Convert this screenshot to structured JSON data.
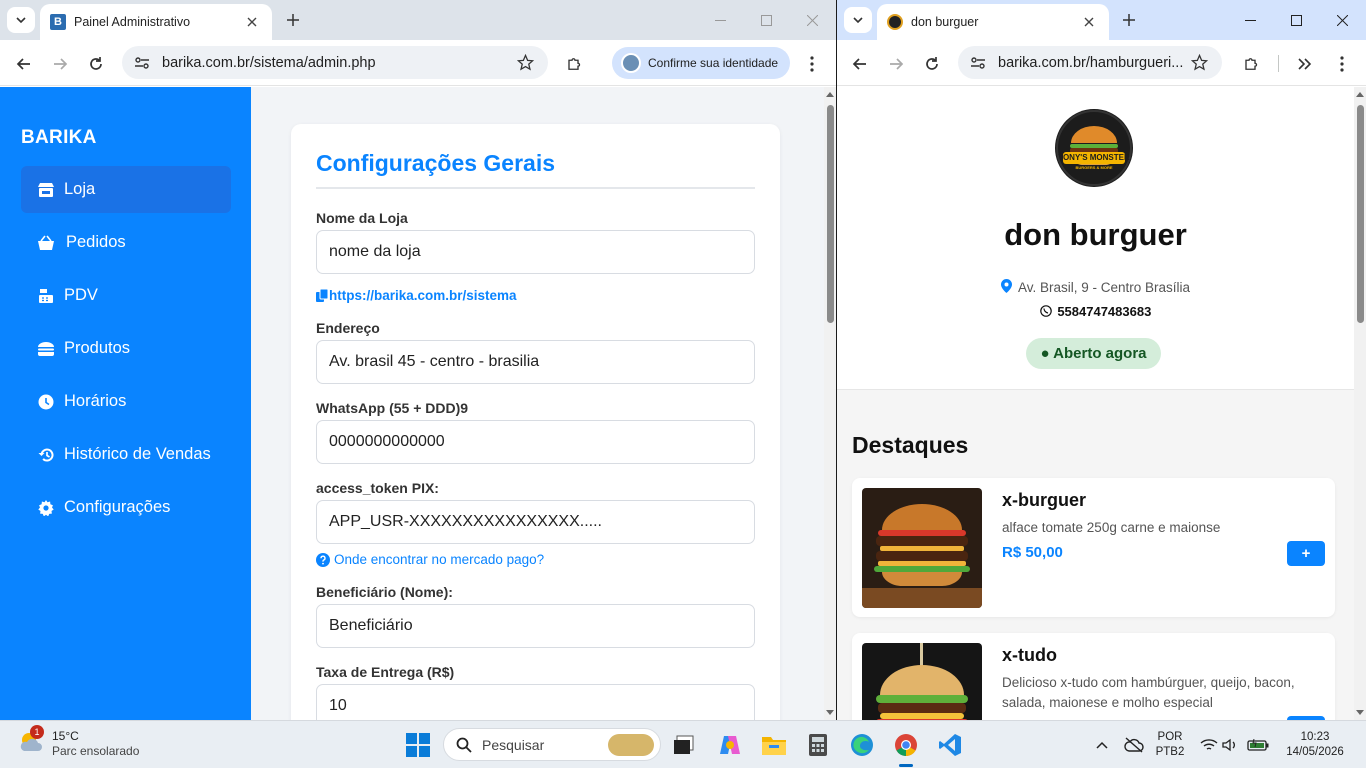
{
  "left_window": {
    "tab_title": "Painel Administrativo",
    "url": "barika.com.br/sistema/admin.php",
    "profile_button": "Confirme sua identidade"
  },
  "admin": {
    "brand": "BARIKA",
    "nav": [
      {
        "label": "Loja",
        "icon": "store-icon",
        "active": true
      },
      {
        "label": "Pedidos",
        "icon": "basket-icon"
      },
      {
        "label": "PDV",
        "icon": "cash-register-icon"
      },
      {
        "label": "Produtos",
        "icon": "burger-icon"
      },
      {
        "label": "Horários",
        "icon": "clock-icon"
      },
      {
        "label": "Histórico de Vendas",
        "icon": "history-icon"
      },
      {
        "label": "Configurações",
        "icon": "gear-icon"
      }
    ],
    "form": {
      "title": "Configurações Gerais",
      "store_name_label": "Nome da Loja",
      "store_name_value": "nome da loja",
      "store_link": "https://barika.com.br/sistema",
      "address_label": "Endereço",
      "address_value": "Av. brasil 45 - centro - brasilia",
      "whatsapp_label": "WhatsApp (55 + DDD)9",
      "whatsapp_value": "0000000000000",
      "pix_label": "access_token PIX:",
      "pix_value": "APP_USR-XXXXXXXXXXXXXXXX.....",
      "pix_help": "Onde encontrar no mercado pago?",
      "beneficiary_label": "Beneficiário (Nome):",
      "beneficiary_value": "Beneficiário",
      "delivery_label": "Taxa de Entrega (R$)",
      "delivery_value": "10"
    }
  },
  "right_window": {
    "tab_title": "don burguer",
    "url": "barika.com.br/hamburgueri..."
  },
  "store": {
    "logo_text": "TONY'S MONSTER",
    "logo_sub": "BURGERS & MORE",
    "name": "don burguer",
    "address": "Av. Brasil, 9 - Centro Brasília",
    "phone": "5584747483683",
    "status": "● Aberto agora",
    "section_title": "Destaques",
    "products": [
      {
        "name": "x-burguer",
        "description": "alface tomate 250g carne e maionse",
        "price": "R$ 50,00",
        "add": "+"
      },
      {
        "name": "x-tudo",
        "description": "Delicioso x-tudo com hambúrguer, queijo, bacon, salada, maionese e molho especial",
        "price": "",
        "add": "+"
      }
    ]
  },
  "taskbar": {
    "weather_temp": "15°C",
    "weather_desc": "Parc ensolarado",
    "weather_badge": "1",
    "search_placeholder": "Pesquisar",
    "lang_line1": "POR",
    "lang_line2": "PTB2",
    "time": "10:23",
    "date": "14/05/2026"
  },
  "colors": {
    "accent": "#0a84ff",
    "sidebar_active": "#1a72e6",
    "open_badge_bg": "#d4edda",
    "open_badge_text": "#155724"
  }
}
